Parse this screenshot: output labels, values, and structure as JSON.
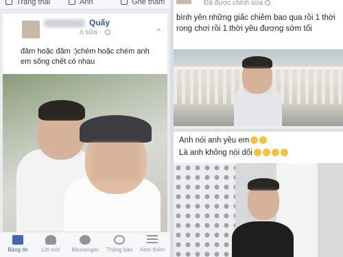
{
  "left": {
    "composer": {
      "status_label": "Trạng thái",
      "photo_label": "Ảnh",
      "checkin_label": "Ghé thăm"
    },
    "post": {
      "author": "Quấy",
      "meta": "n sửa · ",
      "more": "⌄",
      "text": "đâm hoặc đâm :)chém hoặc chém anh em sống chết có nhau"
    },
    "nav": [
      {
        "label": "Bảng tin",
        "icon": "news-feed-icon"
      },
      {
        "label": "Lời mời",
        "icon": "friend-requests-icon"
      },
      {
        "label": "Messenger",
        "icon": "messenger-icon"
      },
      {
        "label": "Thông báo",
        "icon": "globe-notifications-icon"
      },
      {
        "label": "Xem thêm",
        "icon": "menu-icon"
      }
    ]
  },
  "right_top": {
    "meta": "Đã được chỉnh sửa",
    "text": "bình yên những giấc chiêm bao qua rồi 1 thời rong chơi rồi 1 thời yêu đương sớm tối"
  },
  "right_bottom": {
    "line1": "Anh nói anh yêu em",
    "line2": "Là anh không nói dối"
  }
}
